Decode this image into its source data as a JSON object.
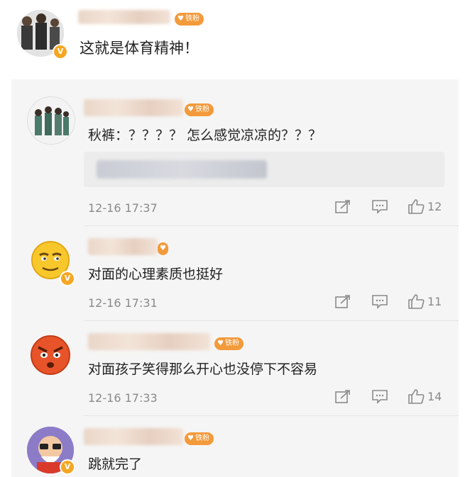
{
  "post": {
    "text": "这就是体育精神！",
    "badge": "铁粉"
  },
  "comments": [
    {
      "text": "秋裤：？？？？ 怎么感觉凉凉的？？？",
      "time": "12-16 17:37",
      "likes": "12",
      "badge": "铁粉"
    },
    {
      "text": "对面的心理素质也挺好",
      "time": "12-16 17:31",
      "likes": "11",
      "badge": ""
    },
    {
      "text": "对面孩子笑得那么开心也没停下不容易",
      "time": "12-16 17:33",
      "likes": "14",
      "badge": "铁粉"
    },
    {
      "text": "跳就完了",
      "time": "",
      "likes": "",
      "badge": "铁粉"
    }
  ],
  "icons": {
    "share": "share-icon",
    "comment": "comment-icon",
    "like": "like-icon",
    "verified": "verified-v-icon"
  },
  "colors": {
    "badge": "#f39a3a",
    "verified": "#f5a623",
    "meta": "#8a8a8a"
  },
  "verified_mark": "V"
}
